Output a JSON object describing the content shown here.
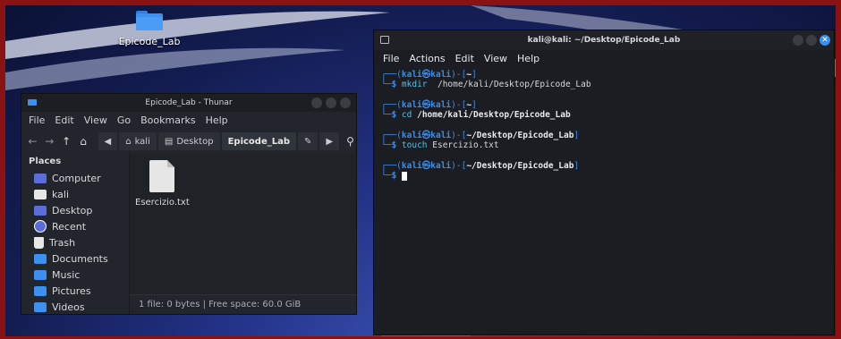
{
  "desktop": {
    "icon_label": "Epicode_Lab"
  },
  "thunar": {
    "title": "Epicode_Lab - Thunar",
    "menu": [
      "File",
      "Edit",
      "View",
      "Go",
      "Bookmarks",
      "Help"
    ],
    "path": [
      "kali",
      "Desktop",
      "Epicode_Lab"
    ],
    "places_header": "Places",
    "places": [
      {
        "label": "Computer",
        "icon": "computer-icon",
        "color": "#5a6dd8"
      },
      {
        "label": "kali",
        "icon": "home-folder-icon",
        "color": "#3d8ff0"
      },
      {
        "label": "Desktop",
        "icon": "desktop-icon",
        "color": "#5a6dd8"
      },
      {
        "label": "Recent",
        "icon": "recent-icon",
        "color": "#5a6dd8"
      },
      {
        "label": "Trash",
        "icon": "trash-icon",
        "color": "#e6e6e6"
      },
      {
        "label": "Documents",
        "icon": "documents-folder-icon",
        "color": "#3d8ff0"
      },
      {
        "label": "Music",
        "icon": "music-folder-icon",
        "color": "#3d8ff0"
      },
      {
        "label": "Pictures",
        "icon": "pictures-folder-icon",
        "color": "#3d8ff0"
      },
      {
        "label": "Videos",
        "icon": "videos-folder-icon",
        "color": "#3d8ff0"
      }
    ],
    "file": {
      "name": "Esercizio.txt"
    },
    "status": "1 file: 0 bytes  |  Free space: 60.0 GiB"
  },
  "terminal": {
    "title": "kali@kali: ~/Desktop/Epicode_Lab",
    "menu": [
      "File",
      "Actions",
      "Edit",
      "View",
      "Help"
    ],
    "blocks": [
      {
        "user": "kali㉿kali",
        "dir": "~",
        "cmd": "mkdir",
        "arg": "/home/kali/Desktop/Epicode_Lab"
      },
      {
        "user": "kali㉿kali",
        "dir": "~",
        "cmd": "cd",
        "arg": "/home/kali/Desktop/Epicode_Lab"
      },
      {
        "user": "kali㉿kali",
        "dir": "~/Desktop/Epicode_Lab",
        "cmd": "touch",
        "arg": "Esercizio.txt"
      },
      {
        "user": "kali㉿kali",
        "dir": "~/Desktop/Epicode_Lab",
        "cmd": "",
        "arg": ""
      }
    ]
  }
}
